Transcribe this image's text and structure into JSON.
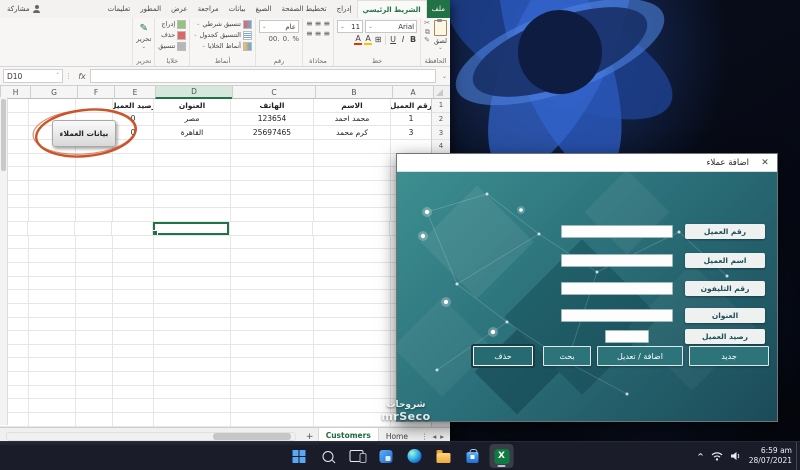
{
  "icons": {
    "close": "✕",
    "dropdown": "⌄",
    "cut": "✂",
    "copy": "⧉",
    "format_painter": "✎",
    "bold": "B",
    "italic": "I",
    "underline": "U",
    "borders": "⊞",
    "letter_a": "A",
    "percent": "%",
    "dec0": ".0",
    "dec00": ".00",
    "align": "≡",
    "fx": "fx",
    "name_caret": "˅",
    "more": "⋮",
    "nav_left": "◂",
    "nav_right": "▸",
    "add_sheet": "+",
    "pencil": "✎",
    "tray_chevron": "^",
    "excel_x": "X"
  },
  "excel": {
    "tabs": [
      "ملف",
      "الشريط الرئيسي",
      "إدراج",
      "تخطيط الصفحة",
      "الصيغ",
      "بيانات",
      "مراجعة",
      "عرض",
      "المطور",
      "تعليمات"
    ],
    "active_tab": "الشريط الرئيسي",
    "share_button": "مشاركة",
    "ribbon": {
      "clipboard_label": "الحافظة",
      "paste_label": "لصق",
      "font_label": "خط",
      "font_name": "Arial",
      "font_size": "11",
      "alignment_label": "محاذاة",
      "number_label": "رقم",
      "number_format": "عام",
      "styles_label": "أنماط",
      "styles_items": [
        "تنسيق شرطي",
        "التنسيق كجدول",
        "أنماط الخلايا"
      ],
      "cells_label": "خلايا",
      "cells_items": [
        "إدراج",
        "حذف",
        "تنسيق"
      ],
      "editing_label": "تحرير"
    },
    "name_box": "D10",
    "formula_value": "",
    "columns": [
      "A",
      "B",
      "C",
      "D",
      "E",
      "F",
      "G",
      "H"
    ],
    "col_widths": {
      "A": 40,
      "B": 76,
      "C": 82,
      "D": 76,
      "E": 40,
      "F": 36,
      "G": 46,
      "H": 29
    },
    "visible_rows": 24,
    "header_row": 1,
    "cells": {
      "1": {
        "A": "رقم العميل",
        "B": "الاسم",
        "C": "الهاتف",
        "D": "العنوان",
        "E": "رصيد العميل"
      },
      "2": {
        "A": "1",
        "B": "محمد احمد",
        "C": "123654",
        "D": "مصر",
        "E": "0"
      },
      "3": {
        "A": "3",
        "B": "كرم محمد",
        "C": "25697465",
        "D": "القاهرة",
        "E": "0"
      }
    },
    "selected_cell": {
      "col": "D",
      "row": 10
    },
    "sheet_button": "بيانات العملاء",
    "sheet_tabs": [
      {
        "label": "Customers",
        "active": true
      },
      {
        "label": "Home",
        "active": false
      }
    ]
  },
  "form": {
    "title": "اضافة عملاء",
    "fields": [
      {
        "label": "رقم العميل",
        "value": ""
      },
      {
        "label": "اسم العميل",
        "value": ""
      },
      {
        "label": "رقم التليفون",
        "value": ""
      },
      {
        "label": "العنوان",
        "value": ""
      },
      {
        "label": "رصيد العميل",
        "value": ""
      }
    ],
    "buttons": [
      {
        "label": "حذف"
      },
      {
        "label": "بحث"
      },
      {
        "label": "اضافة / تعديل"
      },
      {
        "label": "جديد"
      }
    ]
  },
  "taskbar": {
    "time": "6:59 am",
    "date": "28/07/2021"
  },
  "watermark": {
    "line1": "شروحات",
    "line2": "mrSeco"
  },
  "colors": {
    "excel_green": "#217346",
    "form_teal": "#2c737a",
    "form_teal_dark": "#1b4b58",
    "accent_blue": "#2a57b8",
    "taskbar_bg": "#1b1d2b"
  }
}
